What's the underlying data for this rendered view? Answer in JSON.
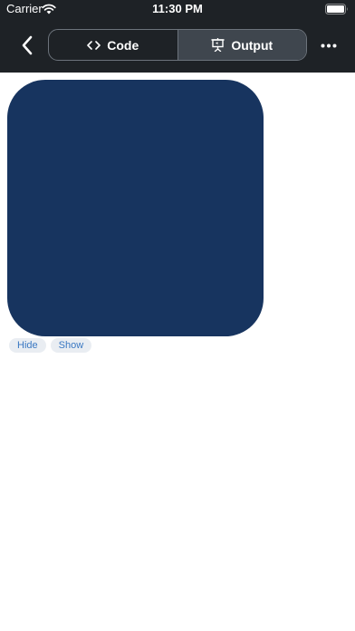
{
  "status_bar": {
    "carrier": "Carrier",
    "time": "11:30 PM"
  },
  "toolbar": {
    "back_icon": "chevron-left-icon",
    "tabs": [
      {
        "label": "Code",
        "icon": "code-brackets-icon",
        "active": false
      },
      {
        "label": "Output",
        "icon": "presentation-icon",
        "active": true
      }
    ],
    "more_icon": "more-horizontal-icon"
  },
  "output": {
    "shape_color": "#17345f",
    "buttons": {
      "hide_label": "Hide",
      "show_label": "Show"
    }
  }
}
